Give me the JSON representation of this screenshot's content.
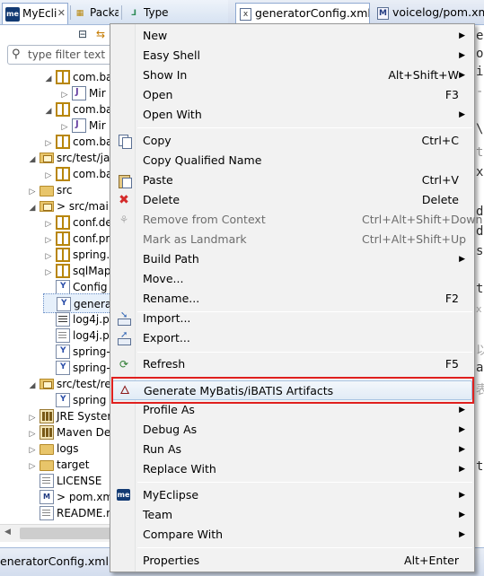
{
  "left_tabs": [
    {
      "label": "MyEcli",
      "icon": "myeclipse-icon"
    },
    {
      "label": "Packa",
      "icon": "package-explorer-icon"
    },
    {
      "label": "Type",
      "icon": "type-hierarchy-icon"
    }
  ],
  "editor_tabs": [
    {
      "label": "generatorConfig.xml",
      "icon": "xml-file-icon",
      "active": true
    },
    {
      "label": "voicelog/pom.xml",
      "icon": "maven-pom-icon",
      "active": false
    }
  ],
  "filter": {
    "placeholder": "type filter text"
  },
  "tree": [
    {
      "label": "com.ba",
      "icon": "package-icon",
      "expanded": true
    },
    {
      "label": "Mir",
      "icon": "java-file-icon",
      "expanded": false
    },
    {
      "label": "com.ba",
      "icon": "package-icon",
      "expanded": true
    },
    {
      "label": "Mir",
      "icon": "java-file-icon",
      "expanded": false
    },
    {
      "label": "com.ba",
      "icon": "package-icon",
      "expanded": false
    },
    {
      "label": "src/test/ja",
      "icon": "source-folder-icon",
      "expanded": true
    },
    {
      "label": "com.ba",
      "icon": "package-icon",
      "expanded": false
    },
    {
      "label": "src",
      "icon": "folder-icon",
      "expanded": false
    },
    {
      "label": "> src/mai",
      "icon": "source-folder-icon",
      "expanded": true
    },
    {
      "label": "conf.de",
      "icon": "package-icon",
      "expanded": false
    },
    {
      "label": "conf.pr",
      "icon": "package-icon",
      "expanded": false
    },
    {
      "label": "spring.",
      "icon": "package-icon",
      "expanded": false
    },
    {
      "label": "sqlMap",
      "icon": "package-icon",
      "expanded": false
    },
    {
      "label": "Config",
      "icon": "xml-file-icon",
      "expanded": false
    },
    {
      "label": "genera",
      "icon": "xml-file-icon",
      "expanded": false,
      "selected": true
    },
    {
      "label": "log4j.p",
      "icon": "properties-file-icon",
      "expanded": false
    },
    {
      "label": "log4j.p",
      "icon": "text-file-icon",
      "expanded": false
    },
    {
      "label": "spring-",
      "icon": "xml-file-icon",
      "expanded": false
    },
    {
      "label": "spring-",
      "icon": "xml-file-icon",
      "expanded": false
    },
    {
      "label": "src/test/re",
      "icon": "source-folder-icon",
      "expanded": true
    },
    {
      "label": "spring",
      "icon": "xml-file-icon",
      "expanded": false
    },
    {
      "label": "JRE Syster",
      "icon": "library-icon",
      "expanded": false
    },
    {
      "label": "Maven De",
      "icon": "library-icon",
      "expanded": false
    },
    {
      "label": "logs",
      "icon": "folder-icon",
      "expanded": false
    },
    {
      "label": "target",
      "icon": "folder-icon",
      "expanded": false
    },
    {
      "label": "LICENSE",
      "icon": "text-file-icon",
      "expanded": false
    },
    {
      "label": "> pom.xm",
      "icon": "maven-pom-icon",
      "expanded": false
    },
    {
      "label": "README.r",
      "icon": "text-file-icon",
      "expanded": false
    }
  ],
  "editor_fragments": [
    "e",
    "o",
    "i",
    "-",
    "\\",
    "t",
    "x",
    "d",
    "d",
    "s",
    "t",
    "x",
    "以",
    "a",
    "表",
    "t"
  ],
  "bottom_tab": {
    "label": "eneratorConfig.xml - v"
  },
  "context_menu": {
    "items": [
      {
        "label": "New",
        "shortcut": "",
        "submenu": true
      },
      {
        "label": "Easy Shell",
        "shortcut": "",
        "submenu": true
      },
      {
        "label": "Show In",
        "shortcut": "Alt+Shift+W",
        "submenu": true
      },
      {
        "label": "Open",
        "shortcut": "F3",
        "submenu": false
      },
      {
        "label": "Open With",
        "shortcut": "",
        "submenu": true
      },
      {
        "label": "Copy",
        "shortcut": "Ctrl+C",
        "submenu": false,
        "icon": "copy-icon"
      },
      {
        "label": "Copy Qualified Name",
        "shortcut": "",
        "submenu": false
      },
      {
        "label": "Paste",
        "shortcut": "Ctrl+V",
        "submenu": false,
        "icon": "paste-icon"
      },
      {
        "label": "Delete",
        "shortcut": "Delete",
        "submenu": false,
        "icon": "delete-icon"
      },
      {
        "label": "Remove from Context",
        "shortcut": "Ctrl+Alt+Shift+Down",
        "submenu": false,
        "disabled": true,
        "icon": "remove-context-icon"
      },
      {
        "label": "Mark as Landmark",
        "shortcut": "Ctrl+Alt+Shift+Up",
        "submenu": false,
        "disabled": true
      },
      {
        "label": "Build Path",
        "shortcut": "",
        "submenu": true
      },
      {
        "label": "Move...",
        "shortcut": "",
        "submenu": false
      },
      {
        "label": "Rename...",
        "shortcut": "F2",
        "submenu": false
      },
      {
        "label": "Import...",
        "shortcut": "",
        "submenu": false,
        "icon": "import-icon"
      },
      {
        "label": "Export...",
        "shortcut": "",
        "submenu": false,
        "icon": "export-icon"
      },
      {
        "label": "Refresh",
        "shortcut": "F5",
        "submenu": false,
        "icon": "refresh-icon"
      },
      {
        "label": "Generate MyBatis/iBATIS Artifacts",
        "shortcut": "",
        "submenu": false,
        "icon": "mybatis-bird-icon",
        "highlighted": true
      },
      {
        "label": "Profile As",
        "shortcut": "",
        "submenu": true
      },
      {
        "label": "Debug As",
        "shortcut": "",
        "submenu": true
      },
      {
        "label": "Run As",
        "shortcut": "",
        "submenu": true
      },
      {
        "label": "Replace With",
        "shortcut": "",
        "submenu": true
      },
      {
        "label": "MyEclipse",
        "shortcut": "",
        "submenu": true,
        "icon": "myeclipse-icon"
      },
      {
        "label": "Team",
        "shortcut": "",
        "submenu": true
      },
      {
        "label": "Compare With",
        "shortcut": "",
        "submenu": true
      },
      {
        "label": "Properties",
        "shortcut": "Alt+Enter",
        "submenu": false
      }
    ]
  },
  "colors": {
    "highlight_border": "#e0201e",
    "menu_bg": "#f2f2f2",
    "selection": "#e6f0fb"
  }
}
